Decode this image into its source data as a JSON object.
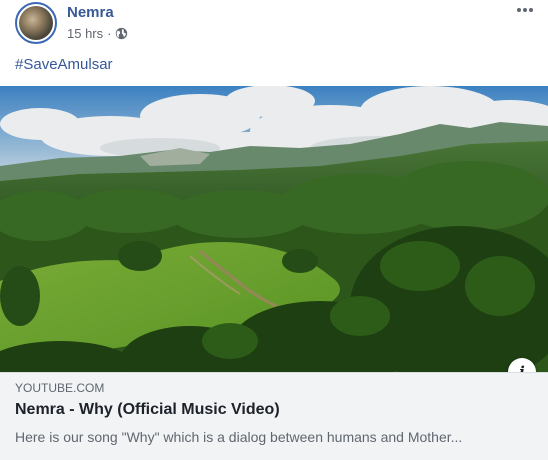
{
  "post": {
    "author": "Nemra",
    "time": "15 hrs",
    "separator": "·",
    "privacy_icon": "globe-icon",
    "more_icon": "more-options-icon",
    "text": "#SaveAmulsar"
  },
  "link_preview": {
    "source": "YOUTUBE.COM",
    "title": "Nemra - Why (Official Music Video)",
    "description": "Here is our song \"Why\" which is a dialog between humans and Mother...",
    "info_label": "i",
    "thumbnail": "aerial forest valley under clouds"
  },
  "colors": {
    "author_blue": "#385898",
    "meta_gray": "#606770",
    "card_bg": "#f2f3f5"
  }
}
